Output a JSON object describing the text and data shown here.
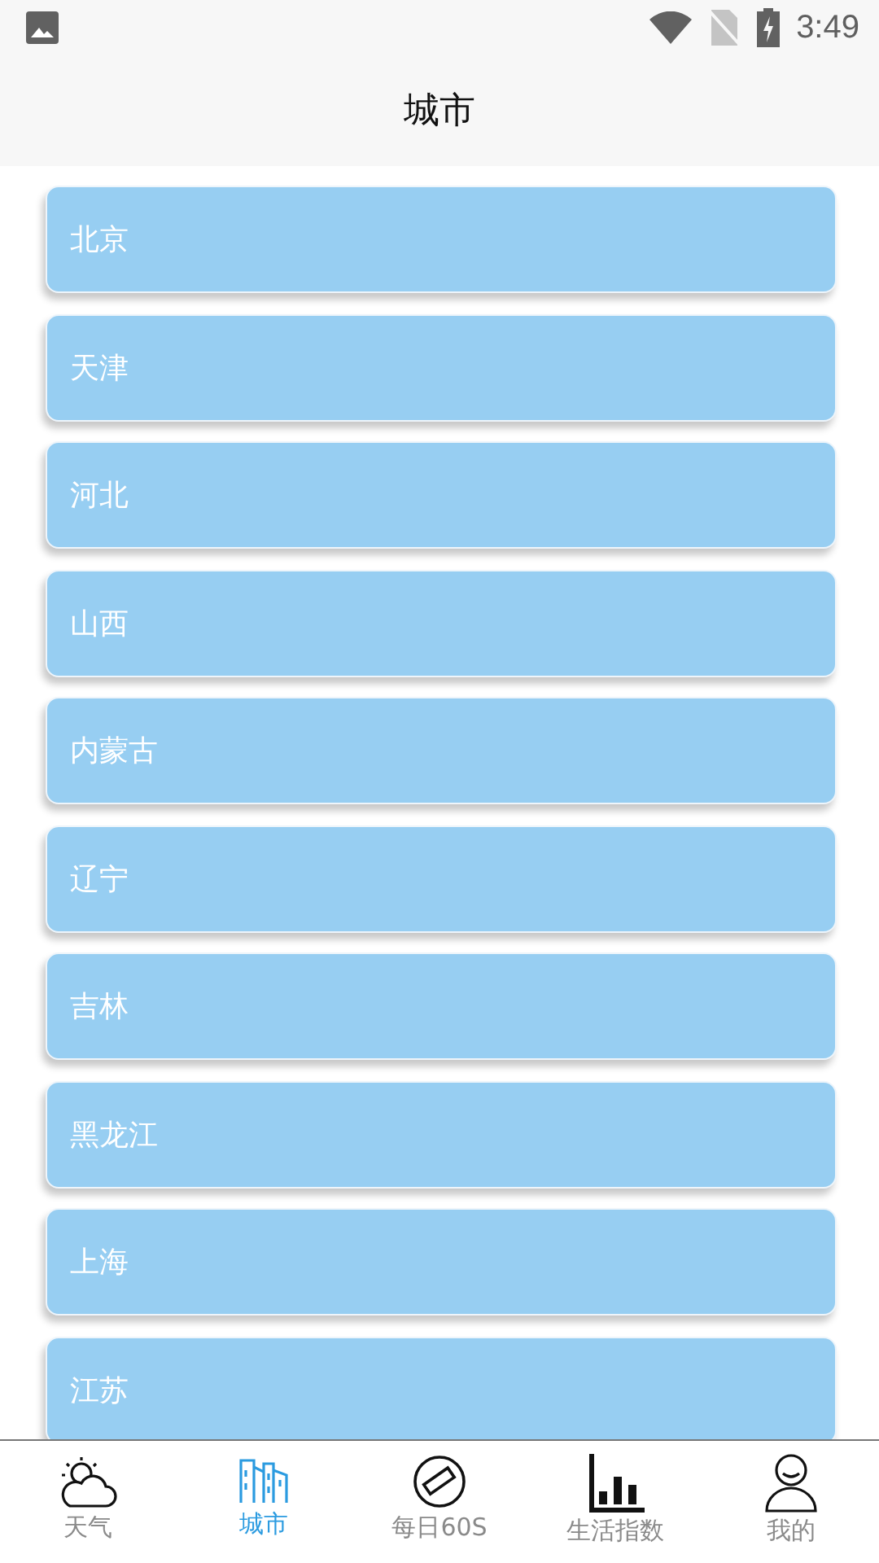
{
  "status_bar": {
    "time": "3:49"
  },
  "title": "城市",
  "cities": [
    {
      "name": "北京"
    },
    {
      "name": "天津"
    },
    {
      "name": "河北"
    },
    {
      "name": "山西"
    },
    {
      "name": "内蒙古"
    },
    {
      "name": "辽宁"
    },
    {
      "name": "吉林"
    },
    {
      "name": "黑龙江"
    },
    {
      "name": "上海"
    },
    {
      "name": "江苏"
    }
  ],
  "tabs": [
    {
      "label": "天气",
      "kind": "weather",
      "selected": false
    },
    {
      "label": "城市",
      "kind": "city",
      "selected": true
    },
    {
      "label": "每日60S",
      "kind": "daily",
      "selected": false
    },
    {
      "label": "生活指数",
      "kind": "index",
      "selected": false
    },
    {
      "label": "我的",
      "kind": "me",
      "selected": false
    }
  ]
}
